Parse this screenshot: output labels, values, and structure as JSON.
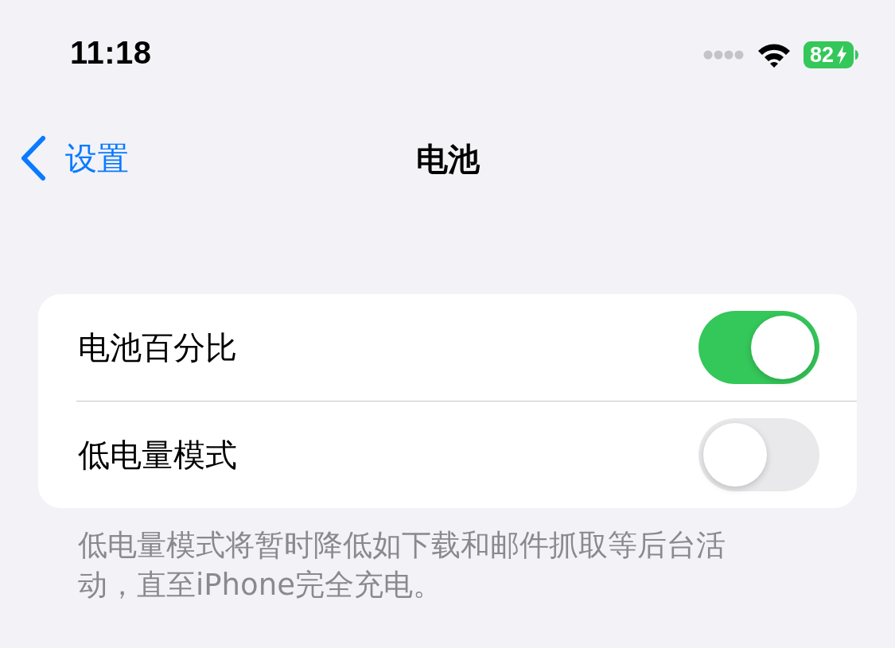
{
  "status_bar": {
    "time": "11:18",
    "battery": "82"
  },
  "nav": {
    "back": "设置",
    "title": "电池"
  },
  "settings": [
    {
      "label": "电池百分比",
      "on": true
    },
    {
      "label": "低电量模式",
      "on": false
    }
  ],
  "footer": "低电量模式将暂时降低如下载和邮件抓取等后台活动，直至iPhone完全充电。"
}
